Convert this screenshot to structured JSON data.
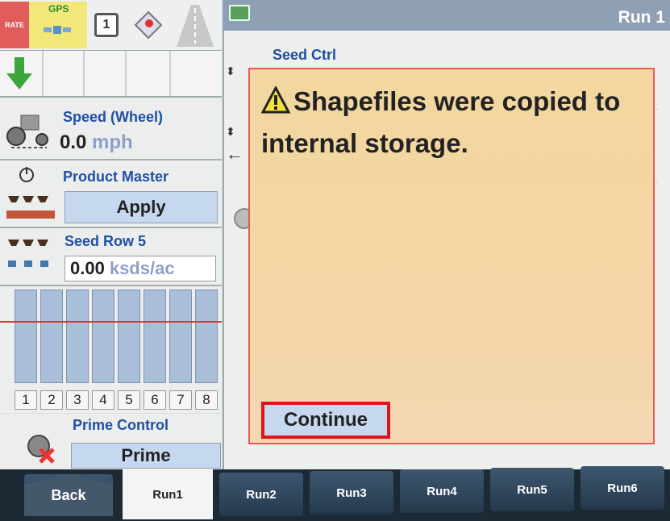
{
  "top_icons": {
    "rate": "RATE",
    "gps": "GPS",
    "one": "1"
  },
  "panels": {
    "speed": {
      "title": "Speed (Wheel)",
      "value": "0.0",
      "unit": "mph"
    },
    "product_master": {
      "title": "Product Master",
      "button": "Apply"
    },
    "seed_row": {
      "title": "Seed Row 5",
      "value": "0.00",
      "unit": "ksds/ac"
    },
    "row_numbers": [
      "1",
      "2",
      "3",
      "4",
      "5",
      "6",
      "7",
      "8"
    ],
    "prime_control": {
      "title": "Prime Control",
      "button": "Prime"
    }
  },
  "right": {
    "run_title": "Run 1",
    "seed_ctrl": "Seed Ctrl"
  },
  "dialog": {
    "message": "Shapefiles were copied to internal storage.",
    "continue": "Continue"
  },
  "tabs": [
    "Back",
    "Run1",
    "Run2",
    "Run3",
    "Run4",
    "Run5",
    "Run6"
  ],
  "colors": {
    "accent": "#1f4fa6",
    "highlight": "#e0141b",
    "dialog_bg": "#f2d7a0"
  }
}
